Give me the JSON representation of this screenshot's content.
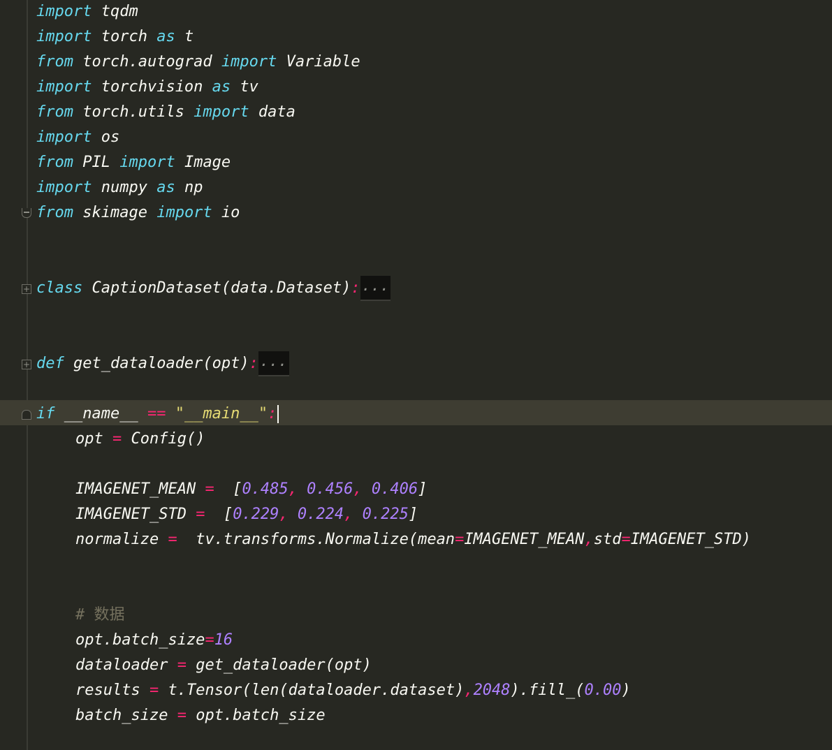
{
  "editor": {
    "theme_colors": {
      "background": "#272822",
      "keyword": "#66d9ef",
      "operator": "#f92672",
      "number": "#ae81ff",
      "string": "#e6db74",
      "comment": "#75715e",
      "text": "#f8f8f2",
      "current_line": "#3e3d32"
    },
    "imports": [
      {
        "kw1": "import",
        "module": " tqdm"
      },
      {
        "kw1": "import",
        "module": " torch ",
        "kw2": "as",
        "alias": " t"
      },
      {
        "kw1": "from",
        "module": " torch.autograd ",
        "kw2": "import",
        "alias": " Variable"
      },
      {
        "kw1": "import",
        "module": " torchvision ",
        "kw2": "as",
        "alias": " tv"
      },
      {
        "kw1": "from",
        "module": " torch.utils ",
        "kw2": "import",
        "alias": " data"
      },
      {
        "kw1": "import",
        "module": " os"
      },
      {
        "kw1": "from",
        "module": " PIL ",
        "kw2": "import",
        "alias": " Image"
      },
      {
        "kw1": "import",
        "module": " numpy ",
        "kw2": "as",
        "alias": " np"
      },
      {
        "kw1": "from",
        "module": " skimage ",
        "kw2": "import",
        "alias": " io"
      }
    ],
    "class_def": {
      "kw": "class",
      "name": " CaptionDataset(data.Dataset)",
      "colon": ":",
      "folded": "..."
    },
    "func_def": {
      "kw": "def",
      "name": " get_dataloader(opt)",
      "colon": ":",
      "folded": "..."
    },
    "main_block": {
      "kw": "if",
      "name": " __name__ ",
      "eq": "==",
      "str": " \"__main__\"",
      "colon": ":"
    },
    "body": {
      "opt_var": "opt ",
      "opt_eq": "=",
      "opt_val": " Config()",
      "mean_var": "IMAGENET_MEAN ",
      "mean_eq": "=",
      "mean_open": "  [",
      "mean_v1": "0.485",
      "mean_v2": "0.456",
      "mean_v3": "0.406",
      "std_var": "IMAGENET_STD ",
      "std_eq": "=",
      "std_open": "  [",
      "std_v1": "0.229",
      "std_v2": "0.224",
      "std_v3": "0.225",
      "close": "]",
      "comma": ", ",
      "norm_var": "normalize ",
      "norm_eq": "=",
      "norm_call": "  tv.transforms.Normalize(mean",
      "norm_eq2": "=",
      "norm_arg1": "IMAGENET_MEAN",
      "norm_comma": ",",
      "norm_std": "std",
      "norm_eq3": "=",
      "norm_arg2": "IMAGENET_STD)",
      "comment_hash": "# ",
      "comment_text": "数据",
      "bs_var": "opt.batch_size",
      "bs_eq": "=",
      "bs_val": "16",
      "dl_var": "dataloader ",
      "dl_eq": "=",
      "dl_val": " get_dataloader(opt)",
      "res_var": "results ",
      "res_eq": "=",
      "res_call": " t.Tensor(len(dataloader.dataset)",
      "res_comma": ",",
      "res_num": "2048",
      "res_fill": ").fill_(",
      "res_num2": "0.00",
      "res_close": ")",
      "bsz_var": "batch_size ",
      "bsz_eq": "=",
      "bsz_val": " opt.batch_size"
    }
  }
}
